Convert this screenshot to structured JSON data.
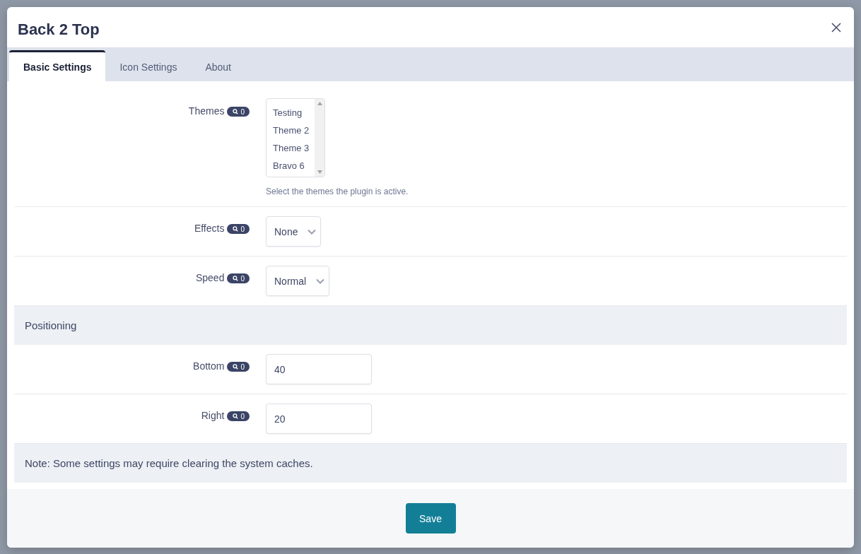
{
  "dialog": {
    "title": "Back 2 Top"
  },
  "tabs": [
    {
      "label": "Basic Settings",
      "selected": true
    },
    {
      "label": "Icon Settings",
      "selected": false
    },
    {
      "label": "About",
      "selected": false
    }
  ],
  "rows": [
    {
      "kind": "multiselect",
      "label": "Themes",
      "badge": "0",
      "options": [
        {
          "label": "Testing",
          "selected": false
        },
        {
          "label": "Theme 2",
          "selected": false
        },
        {
          "label": "Theme 3",
          "selected": false
        },
        {
          "label": "Bravo 6",
          "selected": false
        }
      ],
      "help": "Select the themes the plugin is active."
    },
    {
      "kind": "select",
      "label": "Effects",
      "badge": "0",
      "value": "None"
    },
    {
      "kind": "select",
      "label": "Speed",
      "badge": "0",
      "value": "Normal"
    },
    {
      "kind": "heading",
      "text": "Positioning"
    },
    {
      "kind": "input",
      "label": "Bottom",
      "badge": "0",
      "value": "40"
    },
    {
      "kind": "input",
      "label": "Right",
      "badge": "0",
      "value": "20"
    },
    {
      "kind": "note",
      "text": "Note: Some settings may require clearing the system caches."
    }
  ],
  "footer": {
    "save": "Save"
  }
}
